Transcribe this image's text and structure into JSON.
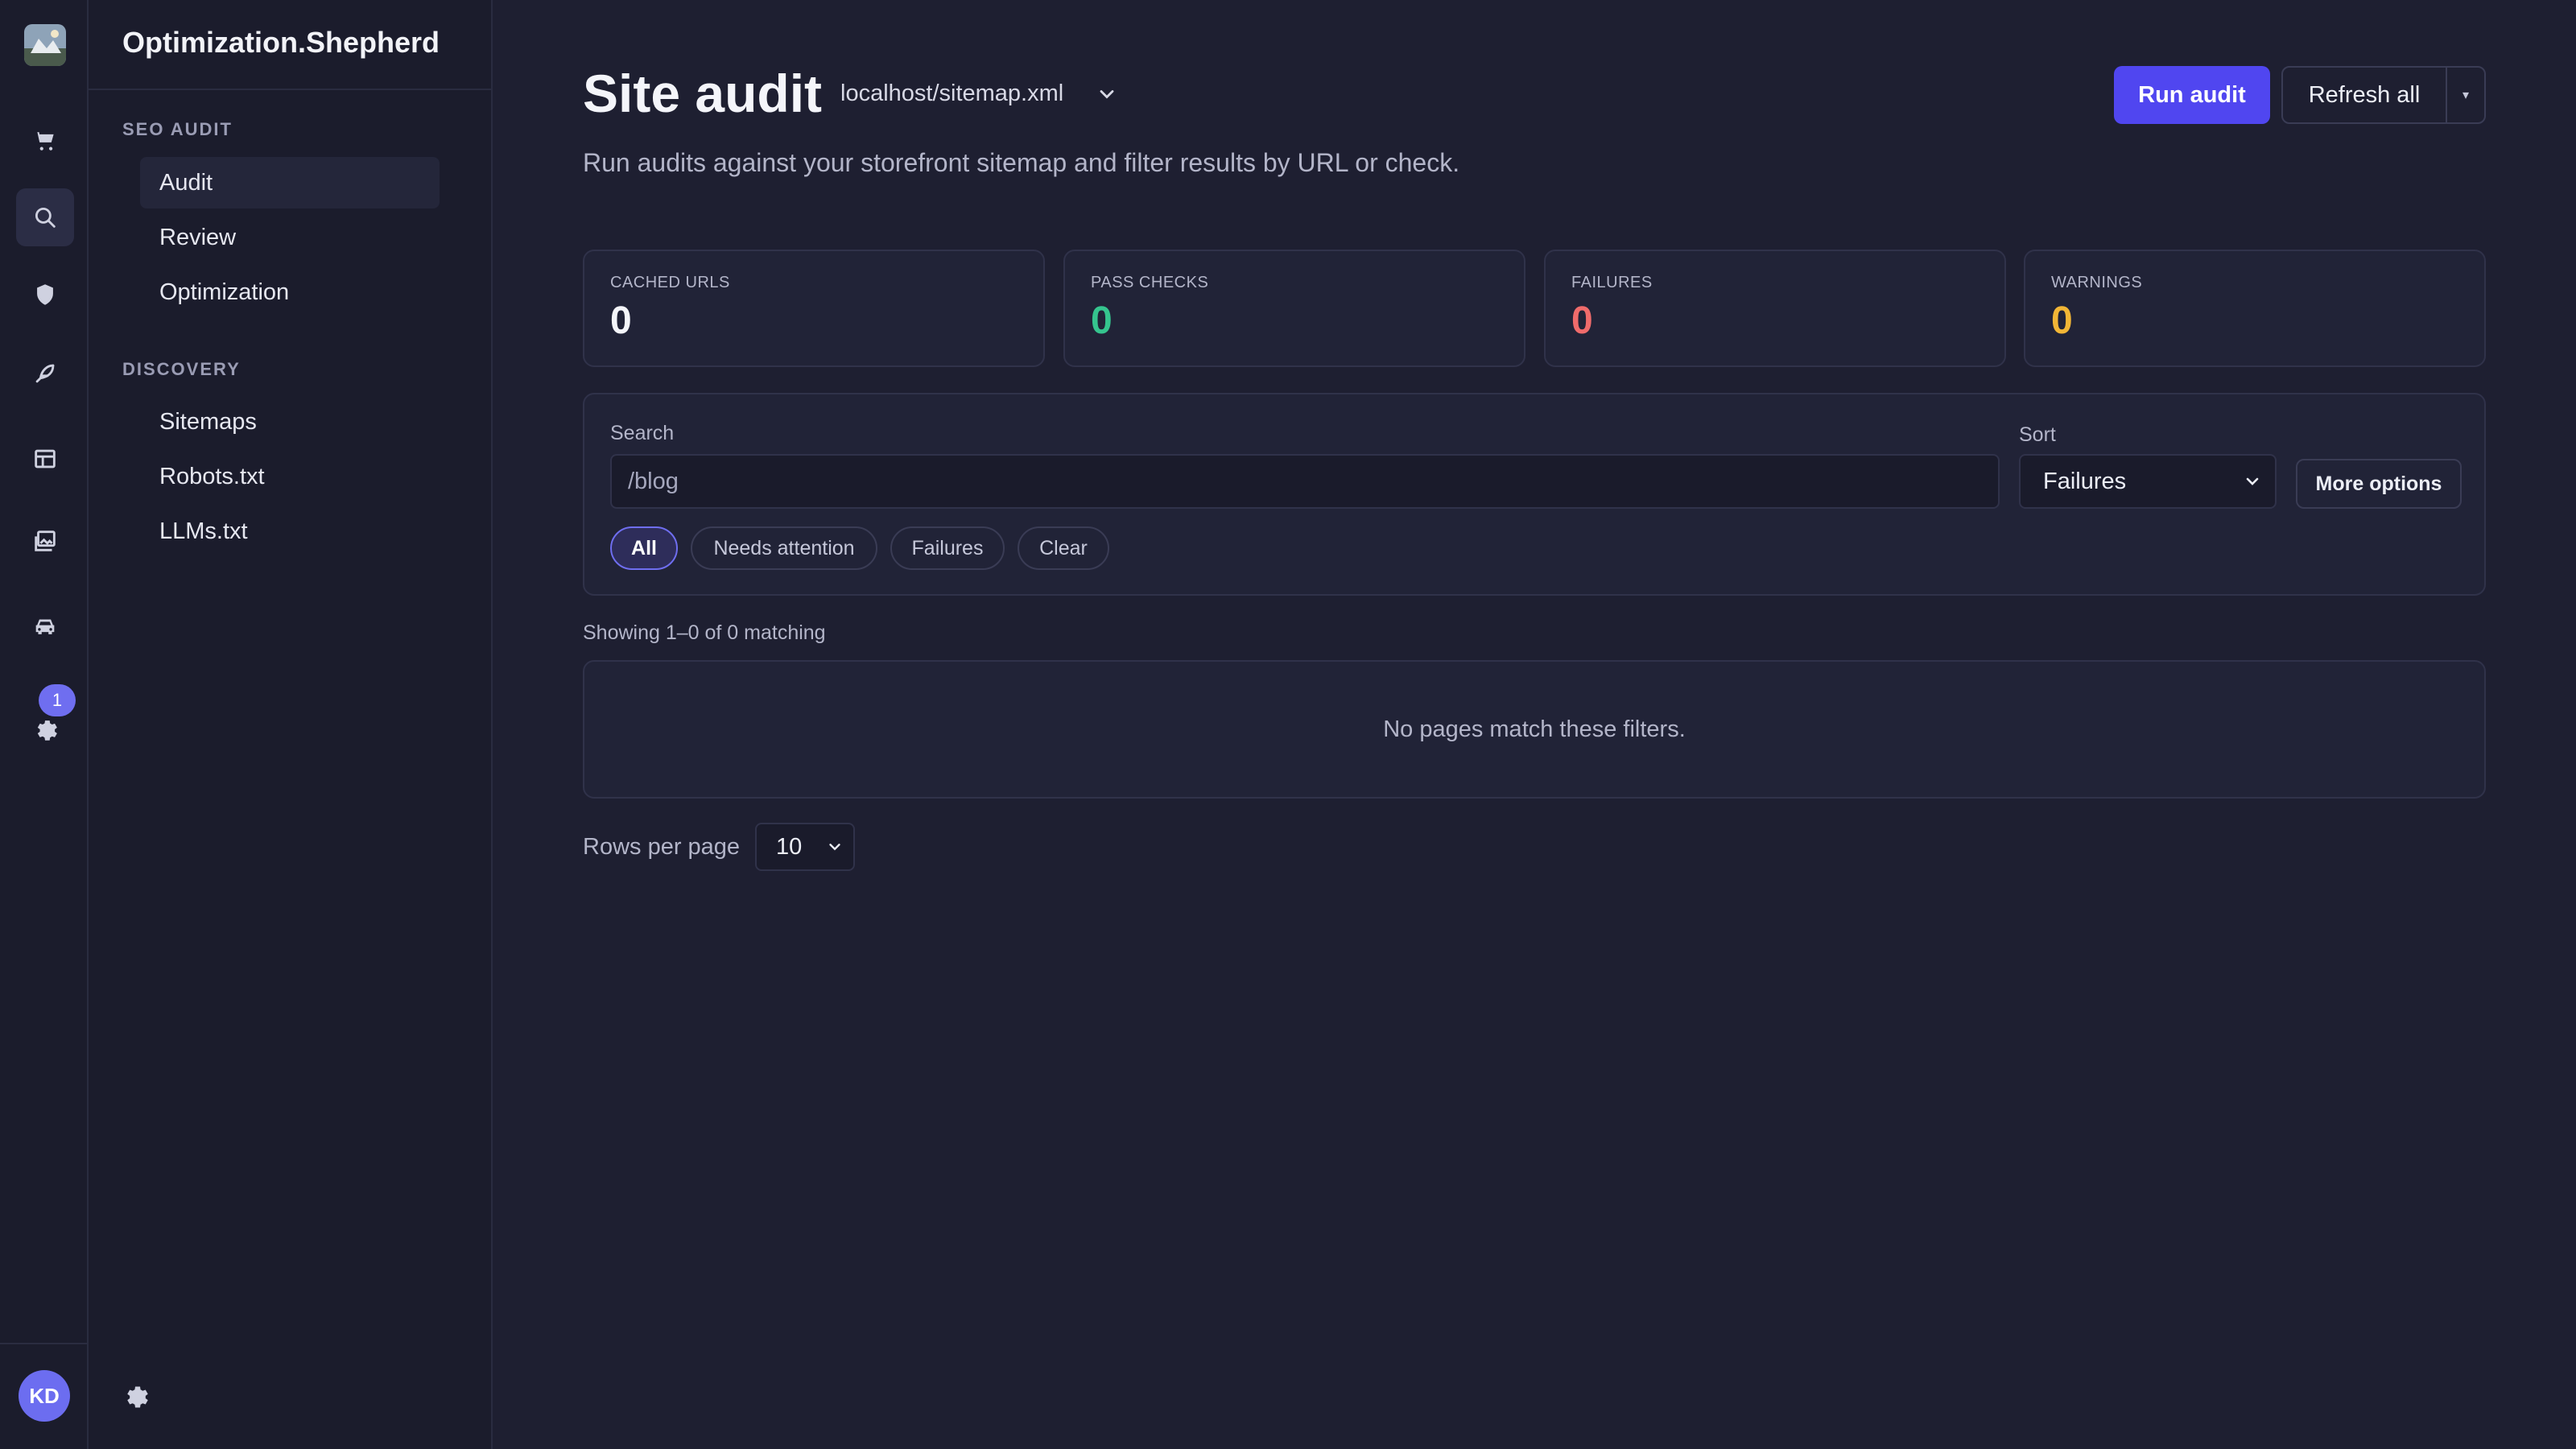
{
  "brand": {
    "name": "Optimization.Shepherd"
  },
  "rail": {
    "notification_count": "1",
    "user_initials": "KD"
  },
  "nav": {
    "sections": [
      {
        "title": "SEO AUDIT",
        "items": [
          "Audit",
          "Review",
          "Optimization"
        ]
      },
      {
        "title": "DISCOVERY",
        "items": [
          "Sitemaps",
          "Robots.txt",
          "LLMs.txt"
        ]
      }
    ],
    "active_item": "Audit"
  },
  "header": {
    "title": "Site audit",
    "sitemap": "localhost/sitemap.xml",
    "subtitle": "Run audits against your storefront sitemap and filter results by URL or check.",
    "run_label": "Run audit",
    "refresh_label": "Refresh all"
  },
  "stats": [
    {
      "label": "CACHED URLS",
      "value": "0",
      "color": "#f4f5fa"
    },
    {
      "label": "PASS CHECKS",
      "value": "0",
      "color": "#35c48e"
    },
    {
      "label": "FAILURES",
      "value": "0",
      "color": "#ef6b6b"
    },
    {
      "label": "WARNINGS",
      "value": "0",
      "color": "#f2b636"
    }
  ],
  "filters": {
    "search_label": "Search",
    "search_placeholder": "/blog",
    "sort_label": "Sort",
    "sort_value": "Failures",
    "more_label": "More options",
    "chips": [
      "All",
      "Needs attention",
      "Failures",
      "Clear"
    ]
  },
  "results": {
    "showing": "Showing 1–0 of 0 matching",
    "empty": "No pages match these filters."
  },
  "pagination": {
    "rows_label": "Rows per page",
    "rows_value": "10"
  },
  "colors": {
    "accent": "#5046f0",
    "background": "#1e1f31",
    "sidebar": "#1b1c2c"
  }
}
